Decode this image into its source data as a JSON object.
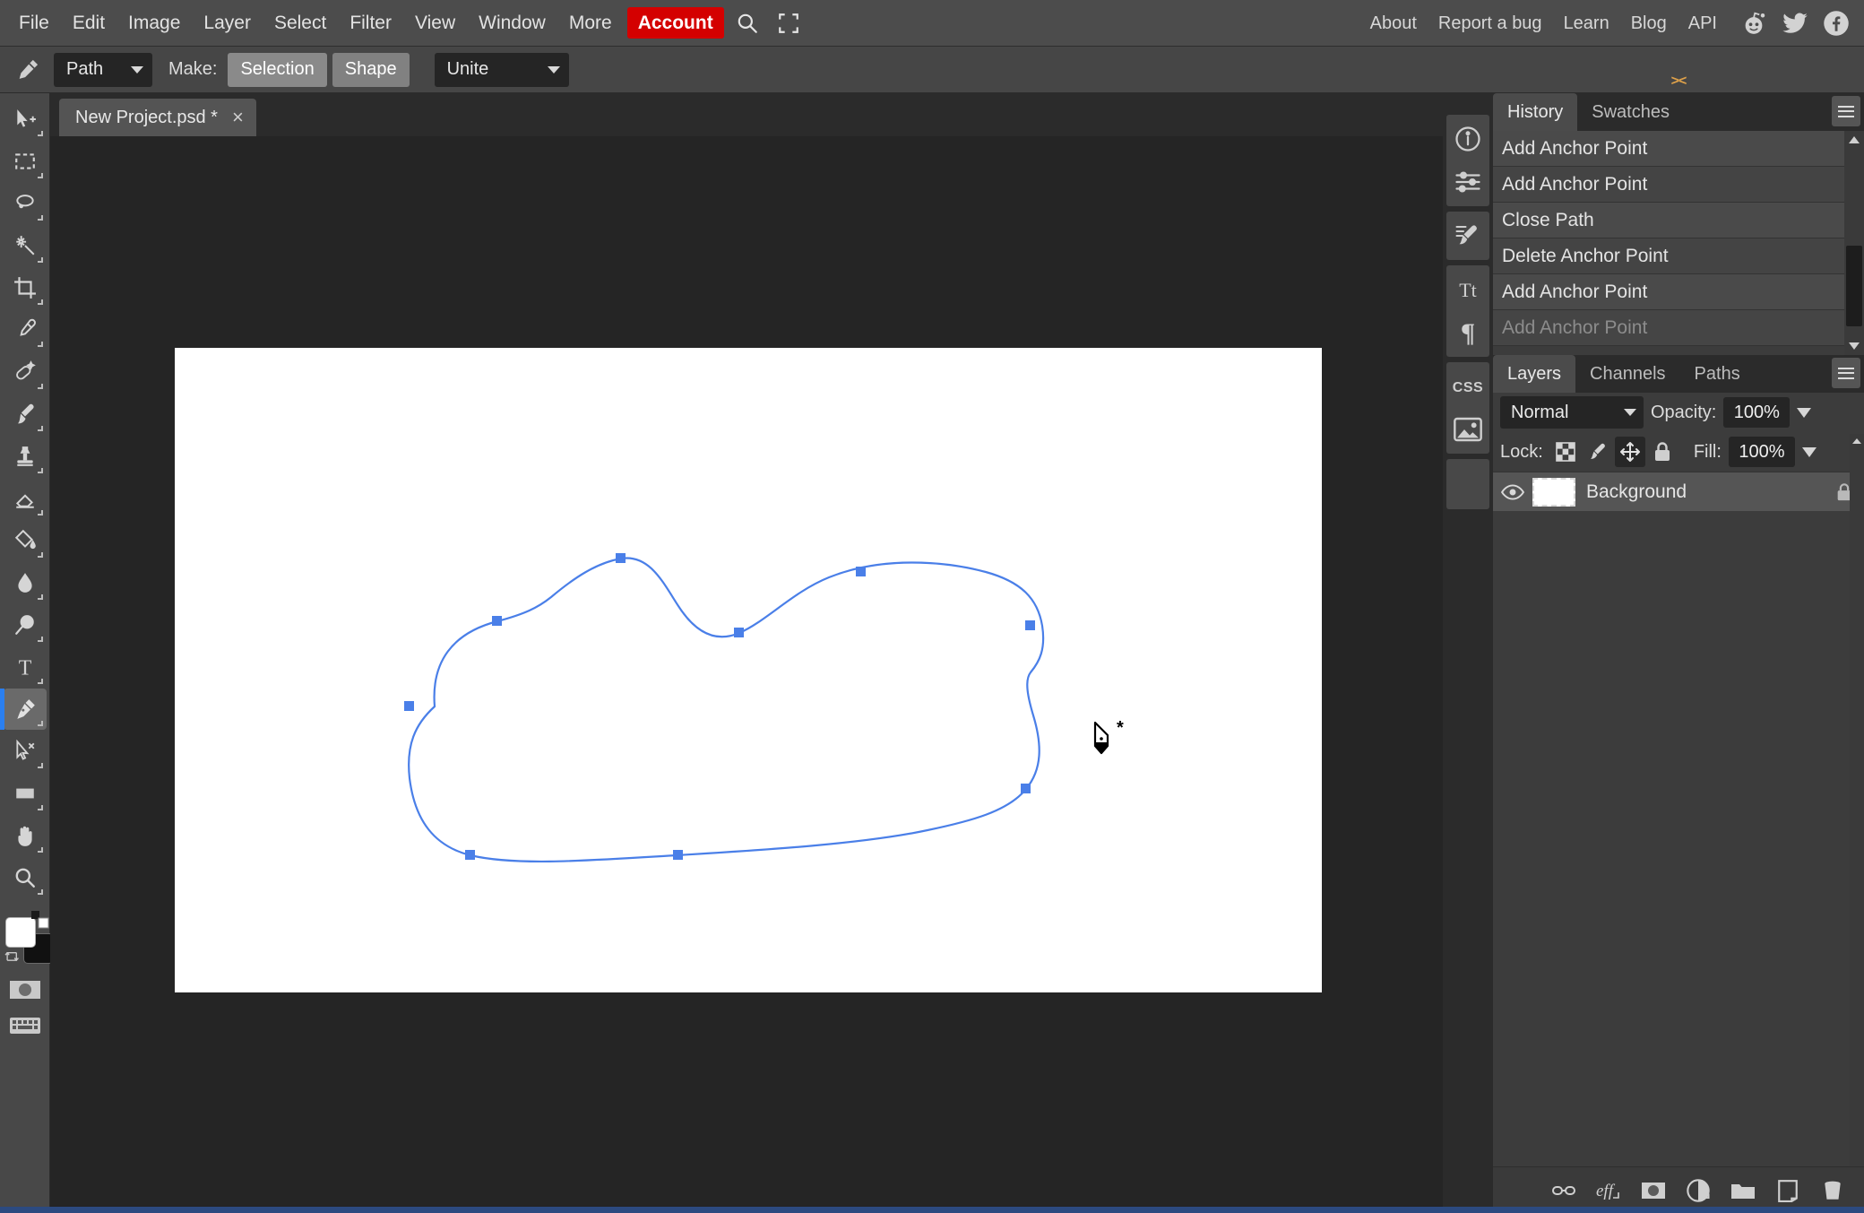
{
  "menubar": {
    "left_items": [
      {
        "label": "File",
        "name": "menu-file"
      },
      {
        "label": "Edit",
        "name": "menu-edit"
      },
      {
        "label": "Image",
        "name": "menu-image"
      },
      {
        "label": "Layer",
        "name": "menu-layer"
      },
      {
        "label": "Select",
        "name": "menu-select"
      },
      {
        "label": "Filter",
        "name": "menu-filter"
      },
      {
        "label": "View",
        "name": "menu-view"
      },
      {
        "label": "Window",
        "name": "menu-window"
      },
      {
        "label": "More",
        "name": "menu-more"
      }
    ],
    "account_label": "Account",
    "account_color": "#d40000",
    "icons": [
      "search-icon",
      "fullscreen-icon"
    ],
    "right_items": [
      {
        "label": "About",
        "name": "menu-about"
      },
      {
        "label": "Report a bug",
        "name": "menu-report-a-bug"
      },
      {
        "label": "Learn",
        "name": "menu-learn"
      },
      {
        "label": "Blog",
        "name": "menu-blog"
      },
      {
        "label": "API",
        "name": "menu-api"
      }
    ],
    "social_icons": [
      "reddit-icon",
      "twitter-icon",
      "facebook-icon"
    ]
  },
  "options_bar": {
    "tool_icon": "pen-tool-icon",
    "mode_value": "Path",
    "make_label": "Make:",
    "selection_label": "Selection",
    "shape_label": "Shape",
    "path_op_value": "Unite"
  },
  "toolbar": {
    "tools": [
      {
        "name": "move-tool",
        "label": "Move"
      },
      {
        "name": "marquee-tool",
        "label": "Rectangular Marquee"
      },
      {
        "name": "lasso-tool",
        "label": "Lasso"
      },
      {
        "name": "magic-wand-tool",
        "label": "Magic Wand"
      },
      {
        "name": "crop-tool",
        "label": "Crop"
      },
      {
        "name": "eyedropper-tool",
        "label": "Eyedropper"
      },
      {
        "name": "healing-brush-tool",
        "label": "Healing Brush"
      },
      {
        "name": "brush-tool",
        "label": "Brush"
      },
      {
        "name": "clone-stamp-tool",
        "label": "Clone Stamp"
      },
      {
        "name": "eraser-tool",
        "label": "Eraser"
      },
      {
        "name": "paint-bucket-tool",
        "label": "Paint Bucket"
      },
      {
        "name": "blur-tool",
        "label": "Blur"
      },
      {
        "name": "dodge-tool",
        "label": "Dodge"
      },
      {
        "name": "type-tool",
        "label": "Type"
      },
      {
        "name": "pen-tool",
        "label": "Pen",
        "active": true
      },
      {
        "name": "path-selection-tool",
        "label": "Path Selection"
      },
      {
        "name": "rectangle-tool",
        "label": "Rectangle"
      },
      {
        "name": "hand-tool",
        "label": "Hand"
      },
      {
        "name": "zoom-tool",
        "label": "Zoom"
      }
    ],
    "foreground_color": "#ffffff",
    "background_color": "#111111",
    "extras": [
      "quick-mask-icon",
      "keyboard-icon"
    ]
  },
  "document": {
    "tab_label": "New Project.psd *",
    "close_label": "×"
  },
  "canvas": {
    "background_color": "#ffffff",
    "path_color": "#4a7fe8",
    "anchor_color": "#4a7fe8",
    "cursor": "pen-add-cursor"
  },
  "rail": {
    "collapse_glyph": "<>",
    "buttons": [
      {
        "name": "info-icon"
      },
      {
        "name": "adjustments-icon"
      },
      {
        "name": "brush-settings-icon"
      },
      {
        "name": "character-icon"
      },
      {
        "name": "paragraph-icon"
      },
      {
        "name": "css-icon"
      },
      {
        "name": "image-icon"
      }
    ]
  },
  "history_panel": {
    "collapse_glyph": "><",
    "tabs": [
      {
        "label": "History",
        "name": "tab-history",
        "active": true
      },
      {
        "label": "Swatches",
        "name": "tab-swatches",
        "active": false
      }
    ],
    "items": [
      {
        "label": "Add Anchor Point",
        "dim": false
      },
      {
        "label": "Add Anchor Point",
        "dim": false
      },
      {
        "label": "Close Path",
        "dim": false
      },
      {
        "label": "Delete Anchor Point",
        "dim": false
      },
      {
        "label": "Add Anchor Point",
        "dim": false
      },
      {
        "label": "Add Anchor Point",
        "dim": true
      }
    ]
  },
  "layers_panel": {
    "tabs": [
      {
        "label": "Layers",
        "name": "tab-layers",
        "active": true
      },
      {
        "label": "Channels",
        "name": "tab-channels",
        "active": false
      },
      {
        "label": "Paths",
        "name": "tab-paths",
        "active": false
      }
    ],
    "blend_mode": "Normal",
    "opacity_label": "Opacity:",
    "opacity_value": "100%",
    "lock_label": "Lock:",
    "lock_buttons": [
      {
        "name": "lock-transparency-icon",
        "on": false
      },
      {
        "name": "lock-paint-icon",
        "on": false
      },
      {
        "name": "lock-position-icon",
        "on": true
      },
      {
        "name": "lock-all-icon",
        "on": false
      }
    ],
    "fill_label": "Fill:",
    "fill_value": "100%",
    "layers": [
      {
        "name": "Background",
        "visible": true,
        "locked": true
      }
    ],
    "bottom_buttons": [
      {
        "name": "link-layers-icon"
      },
      {
        "name": "layer-effects-icon"
      },
      {
        "name": "add-mask-icon"
      },
      {
        "name": "adjustment-layer-icon"
      },
      {
        "name": "new-group-icon"
      },
      {
        "name": "new-layer-icon"
      },
      {
        "name": "delete-layer-icon"
      }
    ]
  }
}
